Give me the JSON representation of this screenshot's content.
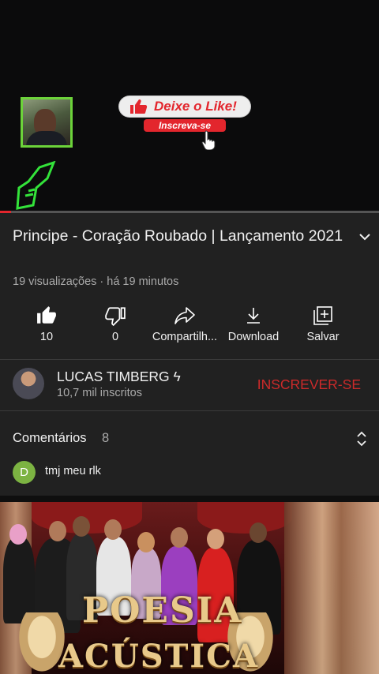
{
  "player": {
    "overlay_like": "Deixe o Like!",
    "overlay_subscribe": "Inscreva-se",
    "progress_fraction": 0.03
  },
  "video": {
    "title": "Principe - Coração Roubado | Lançamento 2021",
    "meta": "19 visualizações · há 19 minutos"
  },
  "actions": {
    "like_count": "10",
    "dislike_count": "0",
    "share_label": "Compartilh...",
    "download_label": "Download",
    "save_label": "Salvar"
  },
  "channel": {
    "name": "LUCAS TIMBERG ϟ",
    "subscribers": "10,7 mil inscritos",
    "subscribe_label": "INSCREVER-SE"
  },
  "comments": {
    "label": "Comentários",
    "count": "8",
    "first_author_initial": "D",
    "first_text": "tmj meu rlk"
  },
  "next_video": {
    "thumb_line1": "POESIA",
    "thumb_line2": "ACÚSTICA"
  },
  "colors": {
    "background": "#212121",
    "accent_red": "#e3262d",
    "subscribe_red": "#cc2a2a",
    "avatar_green": "#7cb342"
  }
}
